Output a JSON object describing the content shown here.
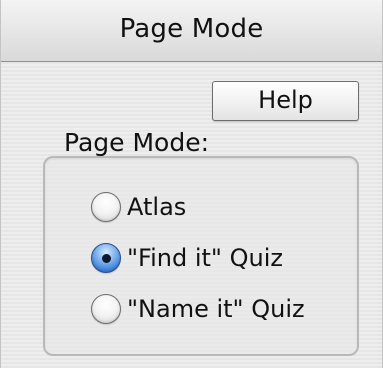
{
  "window": {
    "title": "Page Mode"
  },
  "toolbar": {
    "help_label": "Help"
  },
  "page_mode_group": {
    "label": "Page Mode:",
    "options": [
      {
        "label": "Atlas",
        "selected": false
      },
      {
        "label": "\"Find it\" Quiz",
        "selected": true
      },
      {
        "label": "\"Name it\" Quiz",
        "selected": false
      }
    ]
  }
}
